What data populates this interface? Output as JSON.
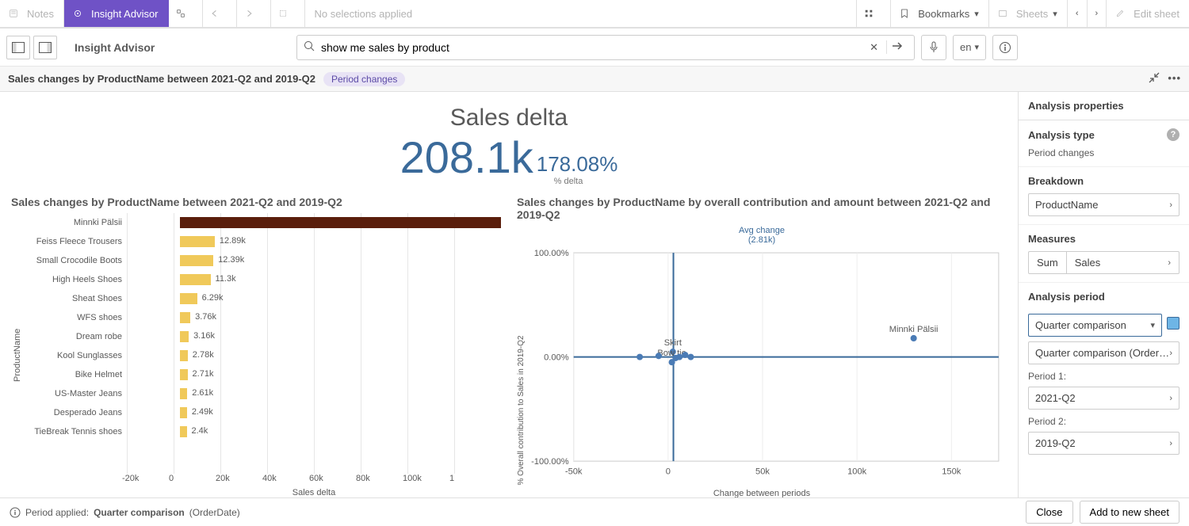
{
  "toolbar": {
    "notes": "Notes",
    "insight_advisor": "Insight Advisor",
    "no_selections": "No selections applied",
    "bookmarks": "Bookmarks",
    "sheets": "Sheets",
    "edit_sheet": "Edit sheet"
  },
  "subbar": {
    "title": "Insight Advisor",
    "search_value": "show me sales by product",
    "lang": "en"
  },
  "crumb": {
    "title": "Sales changes by ProductName between 2021-Q2 and 2019-Q2",
    "pill": "Period changes"
  },
  "kpi": {
    "title": "Sales delta",
    "value": "208.1k",
    "pct": "178.08%",
    "sub": "% delta"
  },
  "bar_chart": {
    "title": "Sales changes by ProductName between 2021-Q2 and 2019-Q2",
    "ylabel": "ProductName",
    "xlabel": "Sales delta"
  },
  "scatter_chart": {
    "title": "Sales changes by ProductName by overall contribution and amount between 2021-Q2 and 2019-Q2",
    "avg_label": "Avg change",
    "avg_value": "(2.81k)",
    "xlabel": "Change between periods",
    "ylabel": "% Overall contribution to Sales in 2019-Q2"
  },
  "right_panel": {
    "header": "Analysis properties",
    "analysis_type_h": "Analysis type",
    "analysis_type_v": "Period changes",
    "breakdown_h": "Breakdown",
    "breakdown_v": "ProductName",
    "measures_h": "Measures",
    "measure_agg": "Sum",
    "measure_field": "Sales",
    "period_h": "Analysis period",
    "period_select": "Quarter comparison",
    "period_detail": "Quarter comparison (OrderD…",
    "p1_label": "Period 1:",
    "p1_val": "2021-Q2",
    "p2_label": "Period 2:",
    "p2_val": "2019-Q2"
  },
  "footer": {
    "period_applied": "Period applied:",
    "comp": "Quarter comparison",
    "field": "(OrderDate)",
    "close": "Close",
    "add": "Add to new sheet"
  },
  "chart_data": {
    "bar": {
      "type": "bar",
      "orientation": "horizontal",
      "ylabel": "ProductName",
      "xlabel": "Sales delta",
      "xlim": [
        -20000,
        120000
      ],
      "xticks": [
        "-20k",
        "0",
        "20k",
        "40k",
        "60k",
        "80k",
        "100k",
        "1"
      ],
      "categories": [
        "Minnki Pälsii",
        "Feiss Fleece Trousers",
        "Small Crocodile Boots",
        "High Heels Shoes",
        "Sheat Shoes",
        "WFS shoes",
        "Dream robe",
        "Kool Sunglasses",
        "Bike Helmet",
        "US-Master Jeans",
        "Desperado Jeans",
        "TieBreak Tennis shoes"
      ],
      "values": [
        130000,
        12890,
        12390,
        11300,
        6290,
        3760,
        3160,
        2780,
        2710,
        2610,
        2490,
        2400
      ],
      "value_labels": [
        "",
        "12.89k",
        "12.39k",
        "11.3k",
        "6.29k",
        "3.76k",
        "3.16k",
        "2.78k",
        "2.71k",
        "2.61k",
        "2.49k",
        "2.4k"
      ]
    },
    "scatter": {
      "type": "scatter",
      "xlabel": "Change between periods",
      "ylabel": "% Overall contribution to Sales in 2019-Q2",
      "xlim": [
        -50000,
        175000
      ],
      "ylim": [
        -100,
        100
      ],
      "xticks": [
        "-50k",
        "0",
        "50k",
        "100k",
        "150k"
      ],
      "yticks": [
        "100.00%",
        "0.00%",
        "-100.00%"
      ],
      "reference_lines": {
        "x": 2810,
        "y": 0
      },
      "avg_change_label": "Avg change (2.81k)",
      "points": [
        {
          "label": "Minnki Pälsii",
          "x": 130000,
          "y": 18
        },
        {
          "label": "Skirt",
          "x": 2500,
          "y": 5
        },
        {
          "label": "Bow tie",
          "x": 2000,
          "y": -5
        },
        {
          "label": "",
          "x": 12000,
          "y": 0
        },
        {
          "label": "",
          "x": 9000,
          "y": 2
        },
        {
          "label": "",
          "x": 6000,
          "y": 0
        },
        {
          "label": "",
          "x": 4000,
          "y": -1
        },
        {
          "label": "",
          "x": -15000,
          "y": 0
        },
        {
          "label": "",
          "x": -5000,
          "y": 1
        }
      ]
    }
  }
}
